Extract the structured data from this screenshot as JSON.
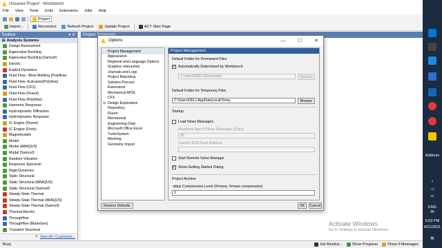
{
  "window": {
    "title": "Unsaved Project - Workbench"
  },
  "menu": [
    "File",
    "View",
    "Tools",
    "Units",
    "Extensions",
    "Jobs",
    "Help"
  ],
  "toolbar1": {
    "project_tab": "Project"
  },
  "toolbar2": [
    "Import...",
    "Reconnect",
    "Refresh Project",
    "Update Project",
    "ACT Start Page"
  ],
  "toolbox": {
    "title": "Toolbox",
    "section": "Analysis Systems",
    "items": [
      {
        "label": "Design Assessment",
        "color": "#4a9a3a"
      },
      {
        "label": "Eigenvalue Buckling",
        "color": "#4a9a3a"
      },
      {
        "label": "Eigenvalue Buckling (Samcef)",
        "color": "#4a9a3a"
      },
      {
        "label": "Electric",
        "color": "#d4a017"
      },
      {
        "label": "Explicit Dynamics",
        "color": "#c0392b"
      },
      {
        "label": "Fluid Flow - Blow Molding (Polyflow)",
        "color": "#3a66b0"
      },
      {
        "label": "Fluid Flow -Extrusion(Polyflow)",
        "color": "#3a66b0"
      },
      {
        "label": "Fluid Flow (CFX)",
        "color": "#3a66b0"
      },
      {
        "label": "Fluid Flow (Fluent)",
        "color": "#d4a017"
      },
      {
        "label": "Fluid Flow (Polyflow)",
        "color": "#3a66b0"
      },
      {
        "label": "Harmonic Response",
        "color": "#4a9a3a"
      },
      {
        "label": "Hydrodynamic Diffraction",
        "color": "#3a66b0"
      },
      {
        "label": "Hydrodynamic Response",
        "color": "#3a66b0"
      },
      {
        "label": "IC Engine (Fluent)",
        "color": "#d4a017"
      },
      {
        "label": "IC Engine (Forte)",
        "color": "#c0392b"
      },
      {
        "label": "Magnetostatic",
        "color": "#d4a017"
      },
      {
        "label": "Modal",
        "color": "#4a9a3a"
      },
      {
        "label": "Modal (ABAQUS)",
        "color": "#4a9a3a"
      },
      {
        "label": "Modal (Samcef)",
        "color": "#4a9a3a"
      },
      {
        "label": "Random Vibration",
        "color": "#4a9a3a"
      },
      {
        "label": "Response Spectrum",
        "color": "#4a9a3a"
      },
      {
        "label": "Rigid Dynamics",
        "color": "#4a9a3a"
      },
      {
        "label": "Static Structural",
        "color": "#4a9a3a"
      },
      {
        "label": "Static Structural (ABAQUS)",
        "color": "#4a9a3a"
      },
      {
        "label": "Static Structural (Samcef)",
        "color": "#4a9a3a"
      },
      {
        "label": "Steady-State Thermal",
        "color": "#c0392b"
      },
      {
        "label": "Steady-State Thermal (ABAQUS)",
        "color": "#c0392b"
      },
      {
        "label": "Steady-State Thermal (Samcef)",
        "color": "#c0392b"
      },
      {
        "label": "Thermal-Electric",
        "color": "#c0392b"
      },
      {
        "label": "Throughflow",
        "color": "#3a66b0"
      },
      {
        "label": "Throughflow (BladeGen)",
        "color": "#3a66b0"
      },
      {
        "label": "Transient Structural",
        "color": "#4a9a3a"
      }
    ],
    "footer_link": "View All / Customize..."
  },
  "schematic": {
    "title": "Project Schematic"
  },
  "watermark": {
    "line1": "Activate Windows",
    "line2": "Go to Settings to activate Windows."
  },
  "status": {
    "left": "Busy",
    "job_monitor": "Job Monitor...",
    "show_progress": "Show Progress",
    "show_messages": "Show 0 Messages"
  },
  "taskbar": {
    "address": "Address",
    "lang1": "ENG",
    "lang2": "IN",
    "time": "5:03 PM",
    "date": "4/21/2021"
  },
  "dialog": {
    "title": "Options",
    "tree": [
      {
        "label": "Project Management",
        "selected": true
      },
      {
        "label": "Appearance"
      },
      {
        "label": "Regional and Language Options"
      },
      {
        "label": "Graphics Interaction"
      },
      {
        "label": "Journals and Logs"
      },
      {
        "label": "Project Reporting"
      },
      {
        "label": "Solution Process"
      },
      {
        "label": "Extensions"
      },
      {
        "label": "Mechanical APDL"
      },
      {
        "label": "CFX"
      },
      {
        "label": "Design Exploration",
        "expander": "⊞"
      },
      {
        "label": "Repository"
      },
      {
        "label": "Fluent"
      },
      {
        "label": "Mechanical"
      },
      {
        "label": "Engineering Data"
      },
      {
        "label": "Microsoft Office Excel"
      },
      {
        "label": "TurboSystem"
      },
      {
        "label": "Meshing"
      },
      {
        "label": "Geometry Import"
      }
    ],
    "restore_button": "Restore Defaults",
    "panel": {
      "header": "Project Management",
      "perm_folder_label": "Default Folder for Permanent Files",
      "auto_workbench_label": "Automatically Determined by Workbench",
      "perm_path": "C:\\Users\\DELL\\Documents",
      "browse": "Browse",
      "temp_folder_label": "Default Folder for Temporary Files",
      "temp_path": "C:\\Users\\DELL\\AppData\\Local\\Temp",
      "startup_label": "Startup",
      "load_news_label": "Load News Messages",
      "max_age_label": "Maximum Age of News Messages (Days)",
      "max_age_value": "90",
      "rss_label": "Custom RSS Feed Address",
      "remote_solve_label": "Start Remote Solve Manager",
      "show_dialog_label": "Show Getting Started Dialog",
      "archive_label": "Project Archive",
      "compression_label": ".wbpz Compression Level (0=none, 9=max compression)",
      "compression_value": "3"
    },
    "ok": "OK",
    "cancel": "Cancel"
  }
}
